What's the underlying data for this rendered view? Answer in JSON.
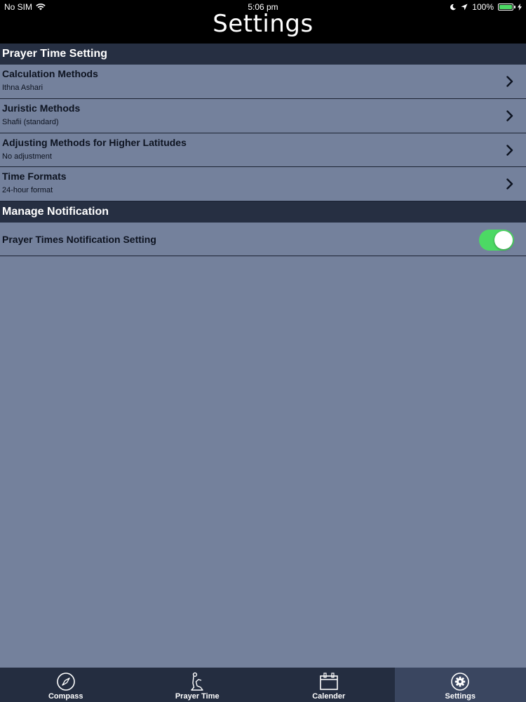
{
  "status_bar": {
    "carrier": "No SIM",
    "time": "5:06 pm",
    "battery": "100%",
    "battery_level": 1.0
  },
  "header": {
    "title": "Settings"
  },
  "sections": {
    "prayer": {
      "header": "Prayer Time Setting",
      "rows": [
        {
          "title": "Calculation Methods",
          "value": "Ithna Ashari"
        },
        {
          "title": "Juristic Methods",
          "value": "Shafii (standard)"
        },
        {
          "title": "Adjusting Methods for Higher Latitudes",
          "value": "No adjustment"
        },
        {
          "title": "Time Formats",
          "value": "24-hour format"
        }
      ]
    },
    "notification": {
      "header": "Manage Notification",
      "rows": [
        {
          "title": "Prayer Times Notification Setting",
          "enabled": true
        }
      ]
    }
  },
  "tabbar": {
    "items": [
      {
        "label": "Compass",
        "icon": "compass-icon"
      },
      {
        "label": "Prayer Time",
        "icon": "prayer-icon"
      },
      {
        "label": "Calender",
        "icon": "calendar-icon"
      },
      {
        "label": "Settings",
        "icon": "gear-icon"
      }
    ],
    "active": "Settings"
  },
  "colors": {
    "background": "#74819c",
    "header_bg": "#262f42",
    "toggle_on": "#4cd964",
    "tabbar_bg": "#242d40",
    "tab_active_bg": "#3a4660"
  }
}
